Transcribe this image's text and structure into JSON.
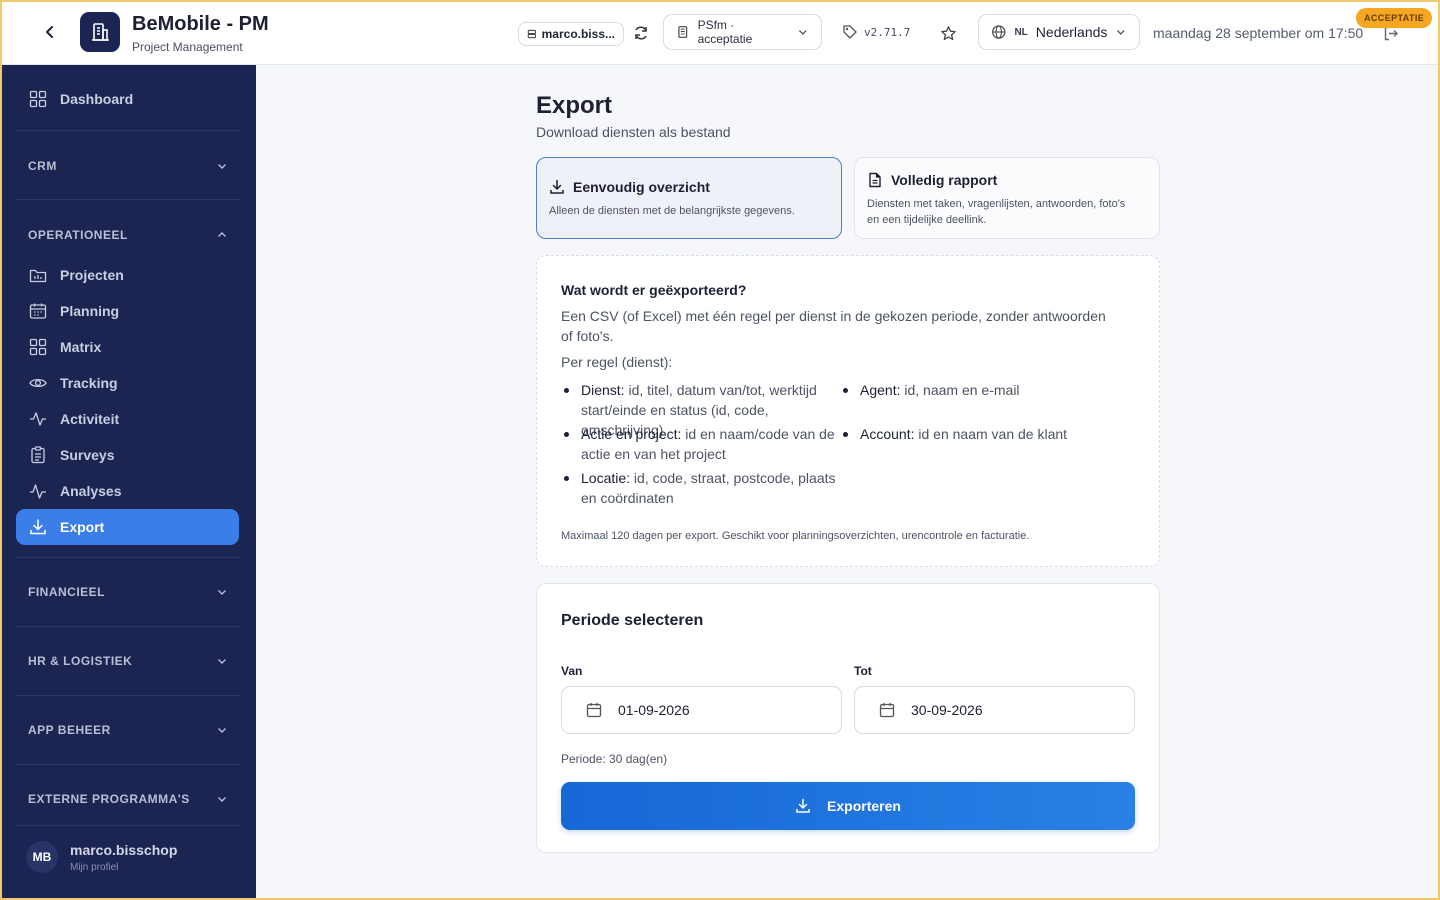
{
  "topbar": {
    "app_title": "BeMobile - PM",
    "app_subtitle": "Project Management",
    "user_pill": "marco.biss...",
    "environment_select": "PSfm · acceptatie",
    "version": "v2.71.7",
    "language_code": "NL",
    "language_label": "Nederlands",
    "datetime": "maandag 28 september om 17:50",
    "env_badge": "ACCEPTATIE"
  },
  "sidebar": {
    "dashboard": "Dashboard",
    "sections": {
      "crm": "CRM",
      "operationeel": "OPERATIONEEL",
      "financieel": "FINANCIEEL",
      "hr": "HR & LOGISTIEK",
      "app": "APP BEHEER",
      "extern": "EXTERNE PROGRAMMA'S"
    },
    "items": [
      {
        "label": "Projecten",
        "icon": "projects-icon"
      },
      {
        "label": "Planning",
        "icon": "calendar-icon"
      },
      {
        "label": "Matrix",
        "icon": "grid-icon"
      },
      {
        "label": "Tracking",
        "icon": "eye-icon"
      },
      {
        "label": "Activiteit",
        "icon": "activity-icon"
      },
      {
        "label": "Surveys",
        "icon": "clipboard-icon"
      },
      {
        "label": "Analyses",
        "icon": "analytics-icon"
      },
      {
        "label": "Export",
        "icon": "download-icon",
        "active": true
      }
    ],
    "profile": {
      "initials": "MB",
      "name": "marco.bisschop",
      "sub": "Mijn profiel"
    }
  },
  "main": {
    "title": "Export",
    "subtitle": "Download diensten als bestand",
    "options": [
      {
        "title": "Eenvoudig overzicht",
        "desc": "Alleen de diensten met de belangrijkste gegevens.",
        "selected": true
      },
      {
        "title": "Volledig rapport",
        "desc": "Diensten met taken, vragenlijsten, antwoorden, foto's en een tijdelijke deellink.",
        "selected": false
      }
    ],
    "info": {
      "title": "Wat wordt er geëxporteerd?",
      "intro": "Een CSV (of Excel) met één regel per dienst in de gekozen periode, zonder antwoorden of foto's.",
      "per_row": "Per regel (dienst):",
      "bullets": [
        {
          "key": "Dienst:",
          "text": " id, titel, datum van/tot, werktijd start/einde en status (id, code, omschrijving)"
        },
        {
          "key": "Agent:",
          "text": " id, naam en e-mail"
        },
        {
          "key": "Actie en project:",
          "text": " id en naam/code van de actie en van het project"
        },
        {
          "key": "Account:",
          "text": " id en naam van de klant"
        },
        {
          "key": "Locatie:",
          "text": " id, code, straat, postcode, plaats en coördinaten"
        }
      ],
      "note": "Maximaal 120 dagen per export. Geschikt voor planningsoverzichten, urencontrole en facturatie."
    },
    "period": {
      "title": "Periode selecteren",
      "from_label": "Van",
      "from_value": "01-09-2026",
      "to_label": "Tot",
      "to_value": "30-09-2026",
      "info": "Periode: 30 dag(en)",
      "export_label": "Exporteren"
    }
  },
  "colors": {
    "sidebar_bg": "#1c2452",
    "accent": "#3b7ee8",
    "badge": "#f5a623",
    "frame": "#f0c96a"
  }
}
